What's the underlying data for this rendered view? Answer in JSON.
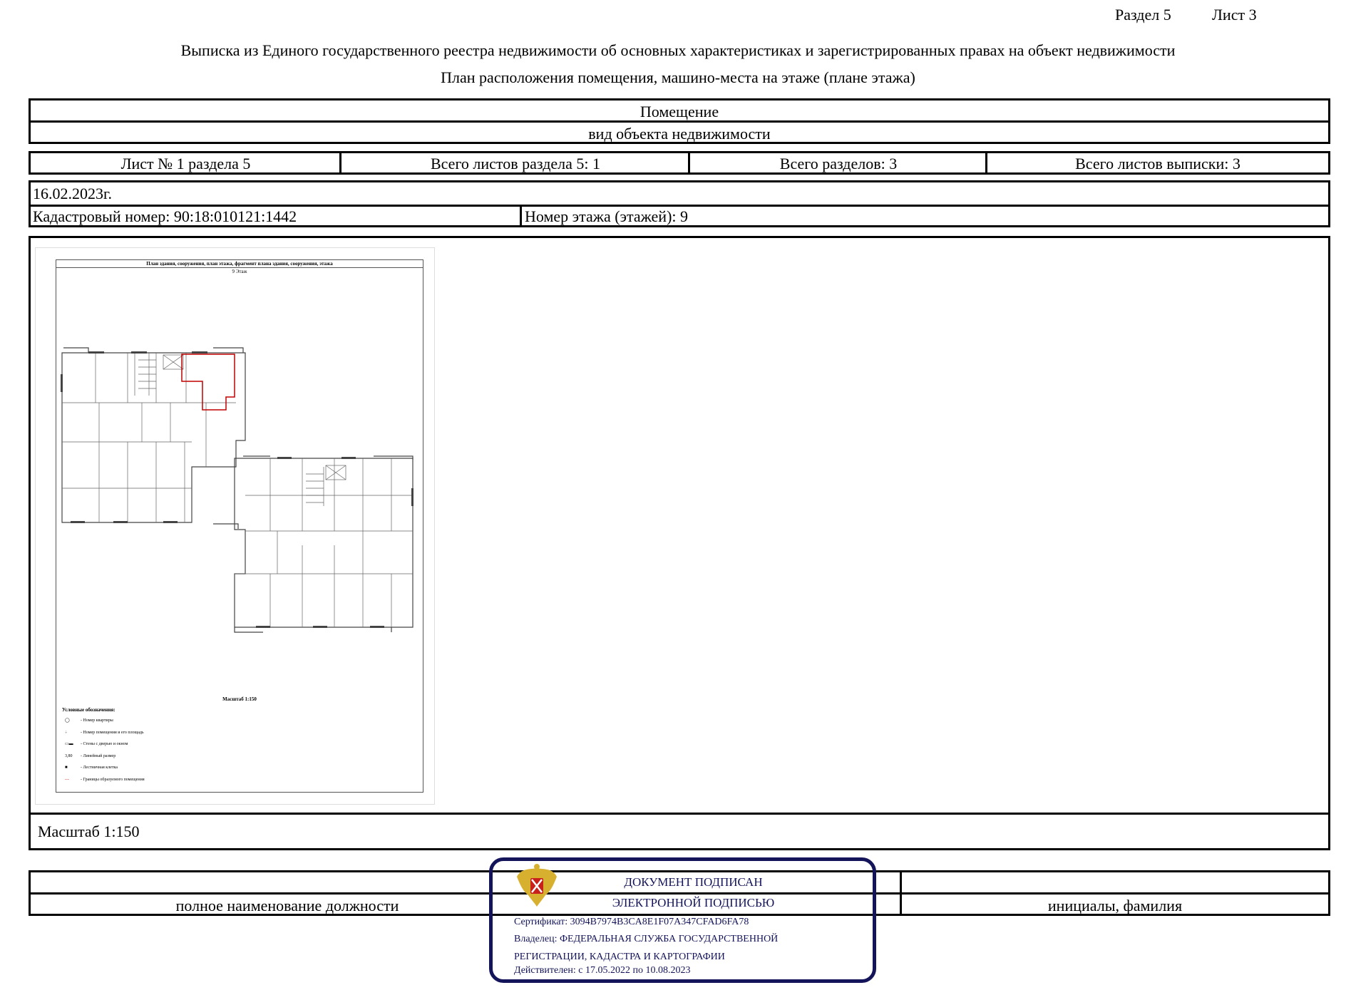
{
  "header": {
    "section": "Раздел 5",
    "sheet": "Лист 3"
  },
  "title": {
    "line1": "Выписка из Единого государственного реестра недвижимости об основных характеристиках и зарегистрированных правах на объект недвижимости",
    "line2": "План расположения помещения, машино-места на этаже (плане этажа)"
  },
  "object": {
    "type": "Помещение",
    "type_caption": "вид объекта недвижимости"
  },
  "sheets": {
    "sheet_no": "Лист № 1 раздела 5",
    "total_section": "Всего листов раздела 5: 1",
    "total_sections": "Всего разделов: 3",
    "total_sheets": "Всего листов выписки: 3"
  },
  "info": {
    "date": "16.02.2023г.",
    "cadastral": "Кадастровый номер: 90:18:010121:1442",
    "floor": "Номер этажа (этажей): 9"
  },
  "plan": {
    "title": "План здания, сооружения, план этажа, фрагмент плана здания, сооружения, этажа",
    "floor_label": "9 Этаж",
    "scale_inner": "Масштаб 1:150",
    "legend_title": "Условные обозначения:",
    "legend": [
      "- Номер квартиры",
      "- Номер помещения и его площадь",
      "- Стены с дверью и окном",
      "- Линейный размер",
      "- Лестничная клетка",
      "- Границы образуемого помещения"
    ],
    "highlight_color": "#c00000"
  },
  "scale": "Масштаб 1:150",
  "signature": {
    "position_caption": "полное наименование должности",
    "name_caption": "инициалы, фамилия"
  },
  "stamp": {
    "line1": "ДОКУМЕНТ ПОДПИСАН",
    "line2": "ЭЛЕКТРОННОЙ ПОДПИСЬЮ",
    "cert": "Сертификат: 3094B7974B3CA8E1F07A347CFAD6FA78",
    "owner1": "Владелец: ФЕДЕРАЛЬНАЯ СЛУЖБА ГОСУДАРСТВЕННОЙ",
    "owner2": "РЕГИСТРАЦИИ, КАДАСТРА И КАРТОГРАФИИ",
    "valid": "Действителен: с 17.05.2022 по 10.08.2023",
    "color": "#14145a"
  }
}
